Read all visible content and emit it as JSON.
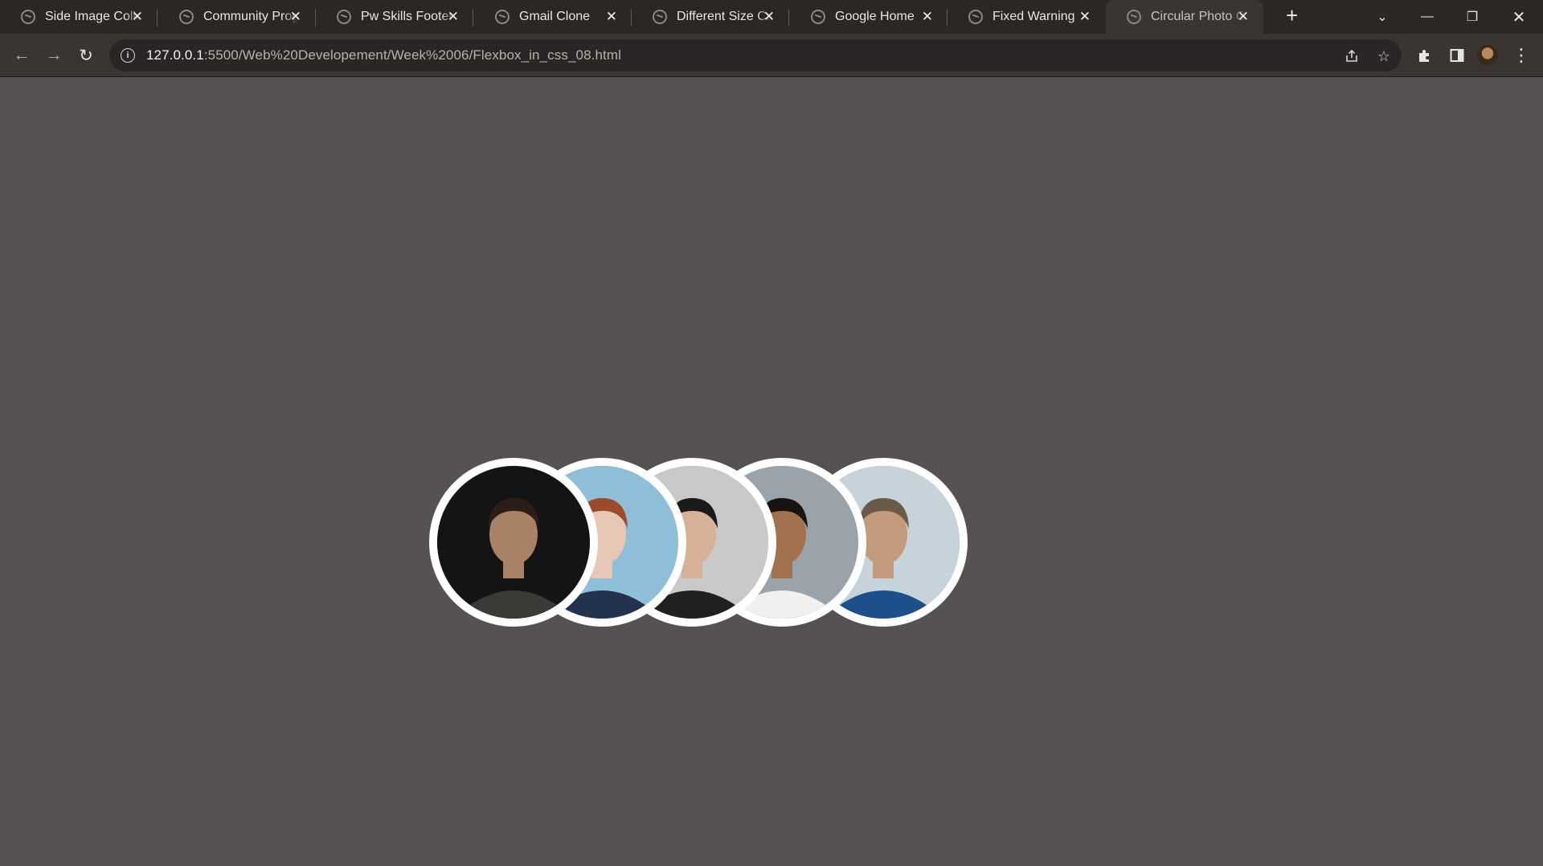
{
  "tabs": [
    {
      "title": "Side Image Collage",
      "close": "✕"
    },
    {
      "title": "Community Programs",
      "close": "✕"
    },
    {
      "title": "Pw Skills Footer",
      "close": "✕"
    },
    {
      "title": "Gmail Clone",
      "close": "✕"
    },
    {
      "title": "Different Size Cards",
      "close": "✕"
    },
    {
      "title": "Google Home",
      "close": "✕"
    },
    {
      "title": "Fixed Warning",
      "close": "✕"
    },
    {
      "title": "Circular Photo Collage",
      "close": "✕",
      "active": true
    }
  ],
  "new_tab": "+",
  "window_controls": {
    "tab_search": "⌄",
    "minimize": "—",
    "restore": "❐",
    "close": "✕"
  },
  "nav": {
    "back": "←",
    "forward": "→",
    "reload": "↻"
  },
  "omnibox": {
    "host": "127.0.0.1",
    "path": ":5500/Web%20Developement/Week%2006/Flexbox_in_css_08.html"
  },
  "photos": [
    {
      "name": "man-dark-sweater",
      "bg": "#141414",
      "skin": "#a98165",
      "hair": "#2b1e16",
      "shirt": "#3a3a36"
    },
    {
      "name": "woman-red-hair",
      "bg": "#8fbfd8",
      "skin": "#e7c7b5",
      "hair": "#9b4a2a",
      "shirt": "#23324f"
    },
    {
      "name": "man-black-hat",
      "bg": "#c9c9c9",
      "skin": "#d6b198",
      "hair": "#1a1a1a",
      "shirt": "#202020"
    },
    {
      "name": "man-white-tshirt",
      "bg": "#9aa3aa",
      "skin": "#a2724f",
      "hair": "#1a1410",
      "shirt": "#f0f0f0"
    },
    {
      "name": "man-glasses-blue-jacket",
      "bg": "#c6d3db",
      "skin": "#c49a7c",
      "hair": "#6a5a48",
      "shirt": "#1d4f8a"
    }
  ]
}
